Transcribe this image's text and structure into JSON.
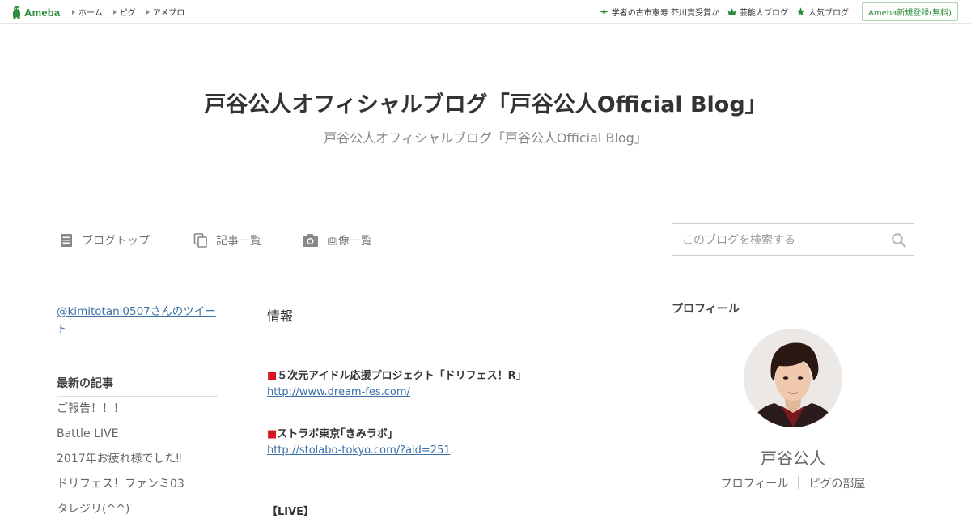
{
  "topbar": {
    "logo_text": "Ameba",
    "nav": [
      "ホーム",
      "ピグ",
      "アメブロ"
    ],
    "right_links": [
      {
        "label": "学者の古市憲寿 芥川賞受賞か",
        "icon": "sparkle-icon"
      },
      {
        "label": "芸能人ブログ",
        "icon": "crown-icon"
      },
      {
        "label": "人気ブログ",
        "icon": "star-icon"
      }
    ],
    "signup_label": "Ameba新規登録(無料)"
  },
  "header": {
    "title": "戸谷公人オフィシャルブログ「戸谷公人Official Blog」",
    "subtitle": "戸谷公人オフィシャルブログ「戸谷公人Official Blog」"
  },
  "navbar": {
    "items": [
      {
        "label": "ブログトップ",
        "icon": "document-icon"
      },
      {
        "label": "記事一覧",
        "icon": "copy-icon"
      },
      {
        "label": "画像一覧",
        "icon": "camera-icon"
      }
    ],
    "search_placeholder": "このブログを検索する"
  },
  "sidebar_left": {
    "tweet_link": "@kimitotani0507さんのツイート",
    "recent_heading": "最新の記事",
    "recent_items": [
      "ご報告！！！",
      "Battle LIVE",
      "2017年お疲れ様でした‼",
      "ドリフェス！ファンミ03",
      "タレジリ(^^)"
    ]
  },
  "main": {
    "entry_title": "情報",
    "sections": [
      {
        "marker": "■",
        "label": "５次元アイドル応援プロジェクト「ドリフェス！R」",
        "link": "http://www.dream-fes.com/"
      },
      {
        "marker": "■",
        "label": "ストラボ東京｢きみラボ｣",
        "link": "http://stolabo-tokyo.com/?aid=251"
      }
    ],
    "live_heading": "【LIVE】"
  },
  "sidebar_right": {
    "profile_heading": "プロフィール",
    "name": "戸谷公人",
    "links": [
      "プロフィール",
      "ピグの部屋"
    ]
  },
  "colors": {
    "brand_green": "#2d8c3c",
    "link_blue": "#3b6fa6",
    "marker_red": "#d6161e"
  }
}
